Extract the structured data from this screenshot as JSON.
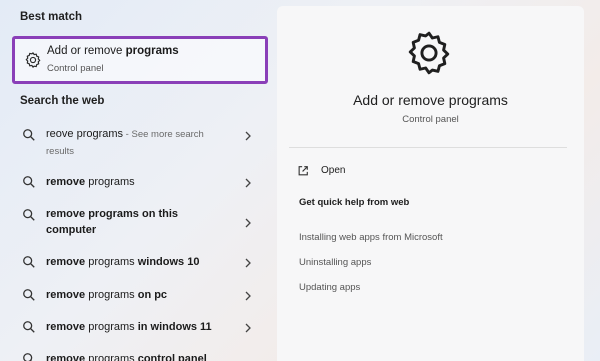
{
  "best_match": {
    "section_label": "Best match",
    "title_prefix": "Add or remove ",
    "title_bold": "programs",
    "subtitle": "Control panel",
    "highlight_color": "#8a3fb8"
  },
  "search_web": {
    "section_label": "Search the web",
    "items": [
      {
        "normal": "reove programs",
        "dim": " - See more search results",
        "bold": "",
        "tail": ""
      },
      {
        "bold": "remove",
        "normal": " programs",
        "dim": "",
        "tail": ""
      },
      {
        "bold": "remove programs on this computer",
        "normal": "",
        "dim": "",
        "tail": ""
      },
      {
        "bold": "remove",
        "normal": " programs ",
        "tail": "windows 10",
        "dim": ""
      },
      {
        "bold": "remove",
        "normal": " programs ",
        "tail": "on pc",
        "dim": ""
      },
      {
        "bold": "remove",
        "normal": " programs ",
        "tail": "in windows 11",
        "dim": ""
      },
      {
        "bold": "remove",
        "normal": " programs ",
        "tail": "control panel",
        "dim": ""
      }
    ]
  },
  "detail": {
    "icon": "gear-icon",
    "title": "Add or remove programs",
    "subtitle": "Control panel",
    "open_label": "Open",
    "help_heading": "Get quick help from web",
    "help_links": [
      "Installing web apps from Microsoft",
      "Uninstalling apps",
      "Updating apps"
    ]
  }
}
